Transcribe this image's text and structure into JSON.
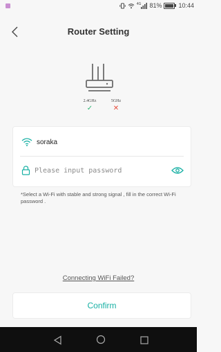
{
  "status_bar": {
    "battery_text": "81%",
    "time": "10:44",
    "network_badge": "4G"
  },
  "header": {
    "title": "Router Setting",
    "back_icon": "chevron-left-icon"
  },
  "router": {
    "icon": "router-icon",
    "bands": [
      {
        "label": "2.4GHz",
        "status": "✓",
        "supported": true
      },
      {
        "label": "5GHz",
        "status": "✕",
        "supported": false
      }
    ]
  },
  "wifi": {
    "ssid": "soraka",
    "password_value": "",
    "password_placeholder": "Please input password",
    "icons": {
      "wifi": "wifi-icon",
      "lock": "lock-icon",
      "eye": "eye-icon"
    }
  },
  "hint": "*Select a Wi-Fi with stable and strong signal , fill in the correct Wi-Fi password .",
  "failed_link": "Connecting WiFi Failed?",
  "confirm_label": "Confirm",
  "colors": {
    "accent": "#18b0a4",
    "ok": "#2bb673",
    "error": "#e74c3c",
    "navbar": "#0f0f0f"
  }
}
